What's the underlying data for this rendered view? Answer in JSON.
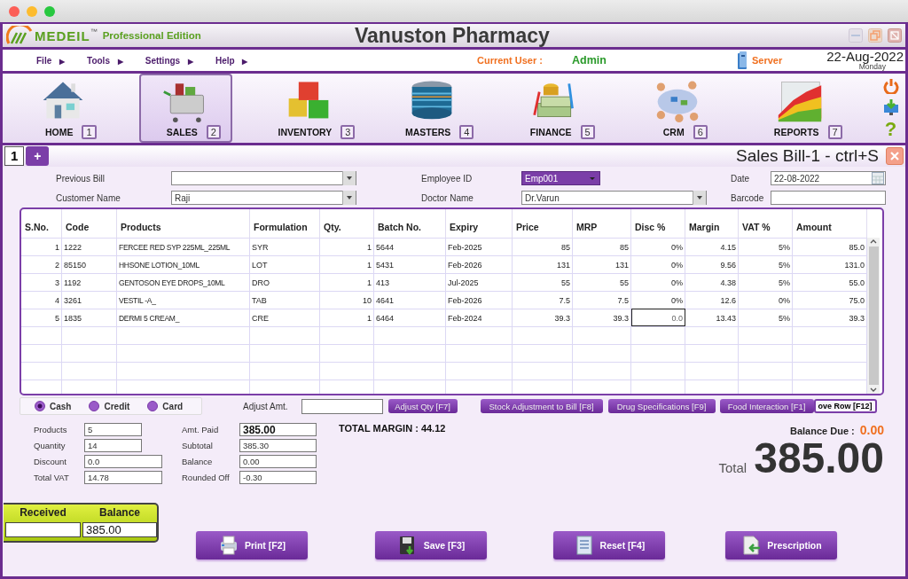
{
  "app": {
    "logo": "MEDEIL",
    "trademark": "™",
    "edition": "Professional Edition",
    "title": "Vanuston Pharmacy"
  },
  "menu": [
    {
      "label": "File",
      "arrow": "▶"
    },
    {
      "label": "Tools",
      "arrow": "▶"
    },
    {
      "label": "Settings",
      "arrow": "▶"
    },
    {
      "label": "Help",
      "arrow": "▶"
    }
  ],
  "user": {
    "label": "Current User :",
    "name": "Admin"
  },
  "server": "Server",
  "date": {
    "day": "22-Aug-2022",
    "weekday": "Monday"
  },
  "modules": [
    {
      "label": "HOME",
      "key": "1",
      "kind": "home",
      "selected": false
    },
    {
      "label": "SALES",
      "key": "2",
      "kind": "sales",
      "selected": true
    },
    {
      "label": "INVENTORY",
      "key": "3",
      "kind": "inventory",
      "selected": false
    },
    {
      "label": "MASTERS",
      "key": "4",
      "kind": "masters",
      "selected": false
    },
    {
      "label": "FINANCE",
      "key": "5",
      "kind": "finance",
      "selected": false
    },
    {
      "label": "CRM",
      "key": "6",
      "kind": "crm",
      "selected": false
    },
    {
      "label": "REPORTS",
      "key": "7",
      "kind": "reports",
      "selected": false
    }
  ],
  "help": "?",
  "bill_tabs": [
    {
      "label": "1",
      "selected": true
    }
  ],
  "add_tab": "+",
  "bill_title": "Sales Bill-1 - ctrl+S",
  "form_fields": [
    {
      "label": "Previous Bill",
      "kind": "combo"
    },
    {
      "label": "Employee ID",
      "value": "Emp001",
      "kind": "select"
    },
    {
      "label": "Date",
      "value": "22-08-2022",
      "kind": "date"
    },
    {
      "label": "Customer Name",
      "value": "Raji",
      "kind": "combo"
    },
    {
      "label": "Doctor Name",
      "value": "Dr.Varun",
      "kind": "combo"
    },
    {
      "label": "Barcode",
      "kind": "text"
    }
  ],
  "table": {
    "columns": [
      "S.No.",
      "Code",
      "Products",
      "Formulation",
      "Qty.",
      "Batch No.",
      "Expiry",
      "Price",
      "MRP",
      "Disc %",
      "Margin",
      "VAT %",
      "Amount"
    ],
    "rows": [
      {
        "cells": [
          "1",
          "1222",
          "FERCEE RED SYP 225ML_225ML",
          "SYR",
          "1",
          "5644",
          "Feb-2025",
          "85",
          "85",
          "0%",
          "4.15",
          "5%",
          "85.0"
        ],
        "editing": false
      },
      {
        "cells": [
          "2",
          "85150",
          "HHSONE LOTION_10ML",
          "LOT",
          "1",
          "5431",
          "Feb-2026",
          "131",
          "131",
          "0%",
          "9.56",
          "5%",
          "131.0"
        ],
        "editing": false
      },
      {
        "cells": [
          "3",
          "1192",
          "GENTOSON EYE DROPS_10ML",
          "DRO",
          "1",
          "413",
          "Jul-2025",
          "55",
          "55",
          "0%",
          "4.38",
          "5%",
          "55.0"
        ],
        "editing": false
      },
      {
        "cells": [
          "4",
          "3261",
          "VESTIL -A_",
          "TAB",
          "10",
          "4641",
          "Feb-2026",
          "7.5",
          "7.5",
          "0%",
          "12.6",
          "0%",
          "75.0"
        ],
        "editing": false
      },
      {
        "cells": [
          "5",
          "1835",
          "DERMI 5 CREAM_",
          "CRE",
          "1",
          "6464",
          "Feb-2024",
          "39.3",
          "39.3",
          "0.0",
          "13.43",
          "5%",
          "39.3"
        ],
        "editing": true
      }
    ]
  },
  "payment_modes": [
    {
      "label": "Cash",
      "selected": true
    },
    {
      "label": "Credit",
      "selected": false
    },
    {
      "label": "Card",
      "selected": false
    }
  ],
  "adjust_label": "Adjust Amt.",
  "action_buttons": [
    "Adjust Qty [F7]",
    "Stock Adjustment to Bill [F8]",
    "Drug Specifications [F9]",
    "Food Interaction [F1]"
  ],
  "remove_row": "ove Row  [F12]",
  "summary_left": [
    {
      "label": "Products",
      "value": "5",
      "kind": "short"
    },
    {
      "label": "Quantity",
      "value": "14",
      "kind": "short"
    },
    {
      "label": "Discount",
      "value": "0.0",
      "kind": "long"
    },
    {
      "label": "Total VAT",
      "value": "14.78",
      "kind": "long"
    }
  ],
  "summary_mid": [
    {
      "label": "Amt. Paid",
      "value": "385.00",
      "kind": "emphasis"
    },
    {
      "label": "Subtotal",
      "value": "385.30",
      "kind": "plain"
    },
    {
      "label": "Balance",
      "value": "0.00",
      "kind": "plain"
    },
    {
      "label": "Rounded Off",
      "value": "-0.30",
      "kind": "plain"
    }
  ],
  "total_margin": "TOTAL MARGIN : 44.12",
  "balance_due": {
    "label": "Balance Due :",
    "value": "0.00"
  },
  "total": {
    "label": "Total",
    "value": "385.00"
  },
  "cash_box": {
    "received_label": "Received",
    "balance_label": "Balance",
    "balance": "385.00"
  },
  "bottom_buttons": [
    {
      "label": "Print  [F2]",
      "kind": "print"
    },
    {
      "label": "Save [F3]",
      "kind": "save"
    },
    {
      "label": "Reset [F4]",
      "kind": "reset"
    },
    {
      "label": "Prescription",
      "kind": "prescription"
    }
  ]
}
